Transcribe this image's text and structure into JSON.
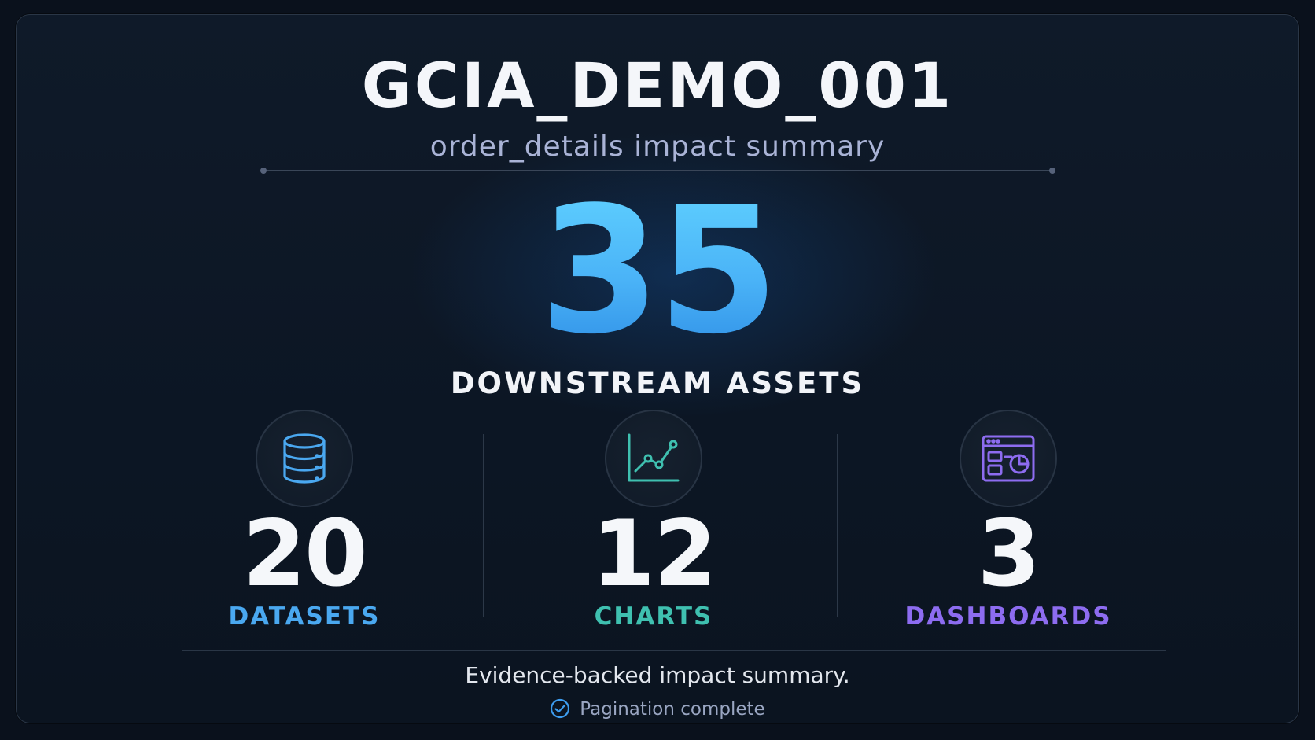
{
  "header": {
    "title": "GCIA_DEMO_001",
    "subtitle": "order_details impact summary"
  },
  "summary": {
    "total": "35",
    "total_label": "DOWNSTREAM ASSETS"
  },
  "stats": [
    {
      "value": "20",
      "label": "DATASETS",
      "icon": "database-icon",
      "color": "#4aa8f0"
    },
    {
      "value": "12",
      "label": "CHARTS",
      "icon": "line-chart-icon",
      "color": "#3fc0b0"
    },
    {
      "value": "3",
      "label": "DASHBOARDS",
      "icon": "dashboard-icon",
      "color": "#8d6cf0"
    }
  ],
  "footer": {
    "note": "Evidence-backed impact summary.",
    "status": "Pagination complete",
    "status_icon": "check-circle-icon",
    "status_icon_color": "#3d9df0"
  },
  "colors": {
    "accent": "#49b8ff",
    "background": "#0c1624",
    "border": "#2a3646"
  }
}
